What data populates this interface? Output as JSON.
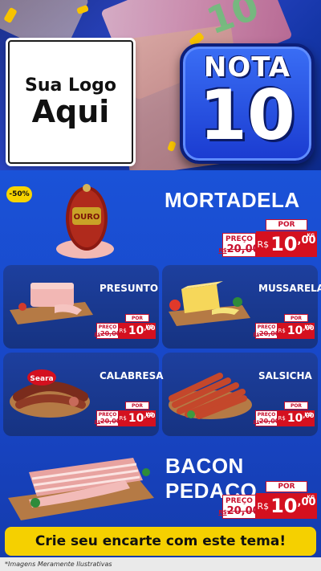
{
  "header": {
    "logo_line1": "Sua Logo",
    "logo_line2": "Aqui",
    "badge_word": "NOTA",
    "badge_number": "10",
    "bill_number": "10"
  },
  "featured": {
    "discount": "-50%",
    "name": "MORTADELA",
    "brand_label": "OURO",
    "price": {
      "preco_label": "PREÇO",
      "old": "20,00",
      "old_prefix": "R$",
      "por_label": "POR",
      "currency": "R$",
      "value": "10",
      "cents": ",00",
      "unit": "KG"
    }
  },
  "grid": [
    {
      "name": "PRESUNTO",
      "price": {
        "preco_label": "PREÇO",
        "old": "20,00",
        "old_prefix": "R$",
        "por_label": "POR",
        "currency": "R$",
        "value": "10",
        "cents": ",00",
        "unit": "KG"
      }
    },
    {
      "name": "MUSSARELA",
      "price": {
        "preco_label": "PREÇO",
        "old": "20,00",
        "old_prefix": "R$",
        "por_label": "POR",
        "currency": "R$",
        "value": "10",
        "cents": ",00",
        "unit": "KG"
      }
    },
    {
      "name": "CALABRESA",
      "brand": "Seara",
      "price": {
        "preco_label": "PREÇO",
        "old": "20,00",
        "old_prefix": "R$",
        "por_label": "POR",
        "currency": "R$",
        "value": "10",
        "cents": ",00",
        "unit": "KG"
      }
    },
    {
      "name": "SALSICHA",
      "price": {
        "preco_label": "PREÇO",
        "old": "20,00",
        "old_prefix": "R$",
        "por_label": "POR",
        "currency": "R$",
        "value": "10",
        "cents": ",00",
        "unit": "KG"
      }
    }
  ],
  "bacon": {
    "name": "BACON PEDAÇO",
    "price": {
      "preco_label": "PREÇO",
      "old": "20,00",
      "old_prefix": "R$",
      "por_label": "POR",
      "currency": "R$",
      "value": "10",
      "cents": ",00",
      "unit": "KG"
    }
  },
  "cta": "Crie seu encarte com este tema!",
  "footer": "*Imagens Meramente Ilustrativas",
  "colors": {
    "accent_yellow": "#f5d000",
    "price_red": "#d4101f",
    "bg_blue": "#1a52d8"
  }
}
